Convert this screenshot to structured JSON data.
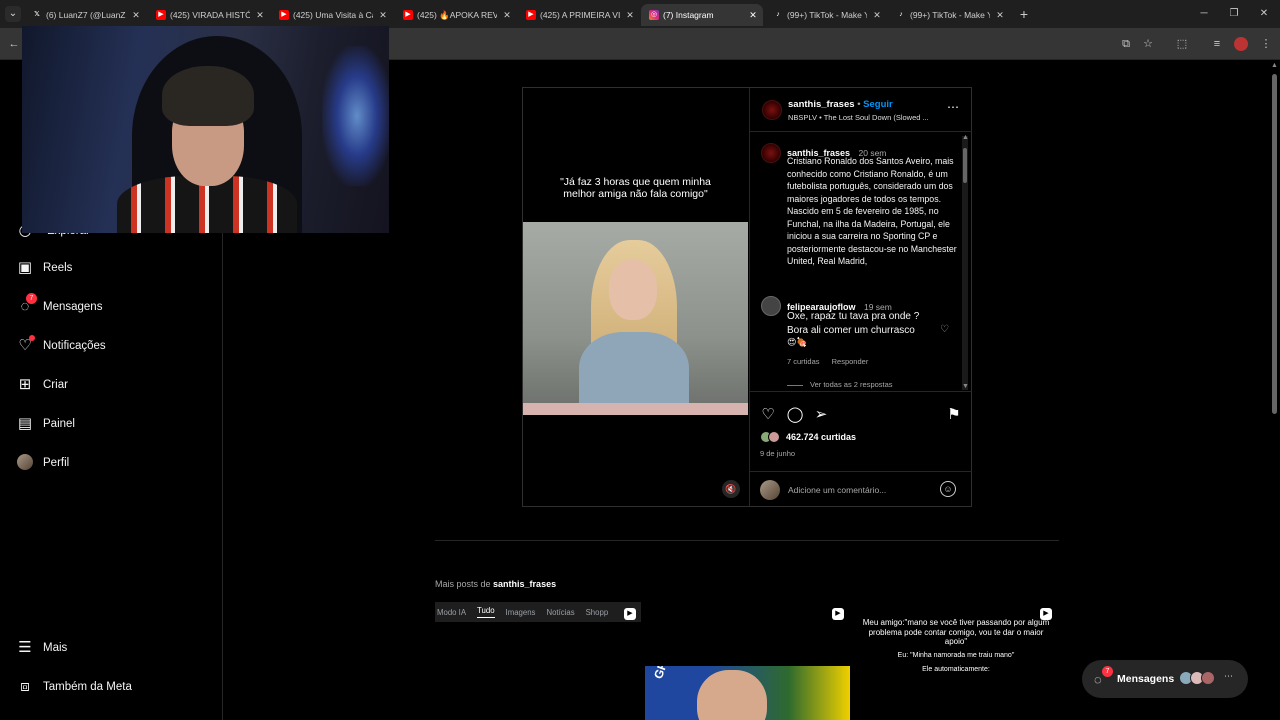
{
  "browser": {
    "tabs": [
      {
        "title": "(6) LuanZ7 (@LuanZ7",
        "icon": "x-logo-icon"
      },
      {
        "title": "(425) VIRADA HISTÓR",
        "icon": "youtube-icon"
      },
      {
        "title": "(425) Uma Visita à Ca",
        "icon": "youtube-icon"
      },
      {
        "title": "(425) 🔥APOKA REVE",
        "icon": "youtube-icon"
      },
      {
        "title": "(425) A PRIMEIRA VI",
        "icon": "youtube-icon"
      },
      {
        "title": "(7) Instagram",
        "icon": "instagram-icon"
      },
      {
        "title": "(99+) TikTok - Make Y",
        "icon": "tiktok-icon"
      },
      {
        "title": "(99+) TikTok - Make Y",
        "icon": "tiktok-icon"
      }
    ],
    "active_tab": 5,
    "accent": "#353535"
  },
  "sidebar": {
    "items": [
      {
        "label": "Reels",
        "icon": "reels-icon"
      },
      {
        "label": "Mensagens",
        "icon": "messenger-icon",
        "badge": "7"
      },
      {
        "label": "Notificações",
        "icon": "heart-icon"
      },
      {
        "label": "Criar",
        "icon": "plus-square-icon"
      },
      {
        "label": "Painel",
        "icon": "dashboard-icon"
      },
      {
        "label": "Perfil",
        "icon": "avatar"
      }
    ],
    "bottom": [
      {
        "label": "Mais",
        "icon": "menu-icon"
      },
      {
        "label": "Também da Meta",
        "icon": "meta-icon"
      }
    ],
    "partial_label": "Explorar"
  },
  "post": {
    "meme_text": "\"Já faz 3 horas que quem minha melhor amiga não fala comigo\"",
    "username": "santhis_frases",
    "dot": "•",
    "follow": "Seguir",
    "audio": "NBSPLV • The Lost Soul Down (Slowed ...",
    "caption": {
      "user": "santhis_frases",
      "time": "20 sem",
      "text": "Cristiano Ronaldo dos Santos Aveiro, mais conhecido como Cristiano Ronaldo, é um futebolista português, considerado um dos maiores jogadores de todos os tempos. Nascido em 5 de fevereiro de 1985, no Funchal, na ilha da Madeira, Portugal, ele iniciou a sua carreira no Sporting CP e posteriormente destacou-se no Manchester United, Real Madrid,"
    },
    "comment": {
      "user": "felipearaujoflow",
      "time": "19 sem",
      "text": "Oxe, rapaz tu tava pra onde ? Bora ali comer um churrasco",
      "emoji": "😍🍖",
      "likes": "7 curtidas",
      "reply": "Responder",
      "view_replies": "Ver todas as 2 respostas"
    },
    "likes": "462.724 curtidas",
    "date": "9 de junho",
    "comment_placeholder": "Adicione um comentário..."
  },
  "more_posts": {
    "prefix": "Mais posts de",
    "user": "santhis_frases"
  },
  "filters": [
    "Modo IA",
    "Tudo",
    "Imagens",
    "Notícias",
    "Shopp"
  ],
  "filter_active": 1,
  "thumb2": {
    "line1": "Meu amigo:\"mano se você tiver passando por algum problema pode contar comigo, vou te dar o maior apoio\"",
    "line2": "Eu: \"Minha namorada me traiu mano\"",
    "line3": "Ele automaticamente:"
  },
  "lula_word": "GRO",
  "messages_pill": {
    "label": "Mensagens",
    "badge": "7"
  }
}
